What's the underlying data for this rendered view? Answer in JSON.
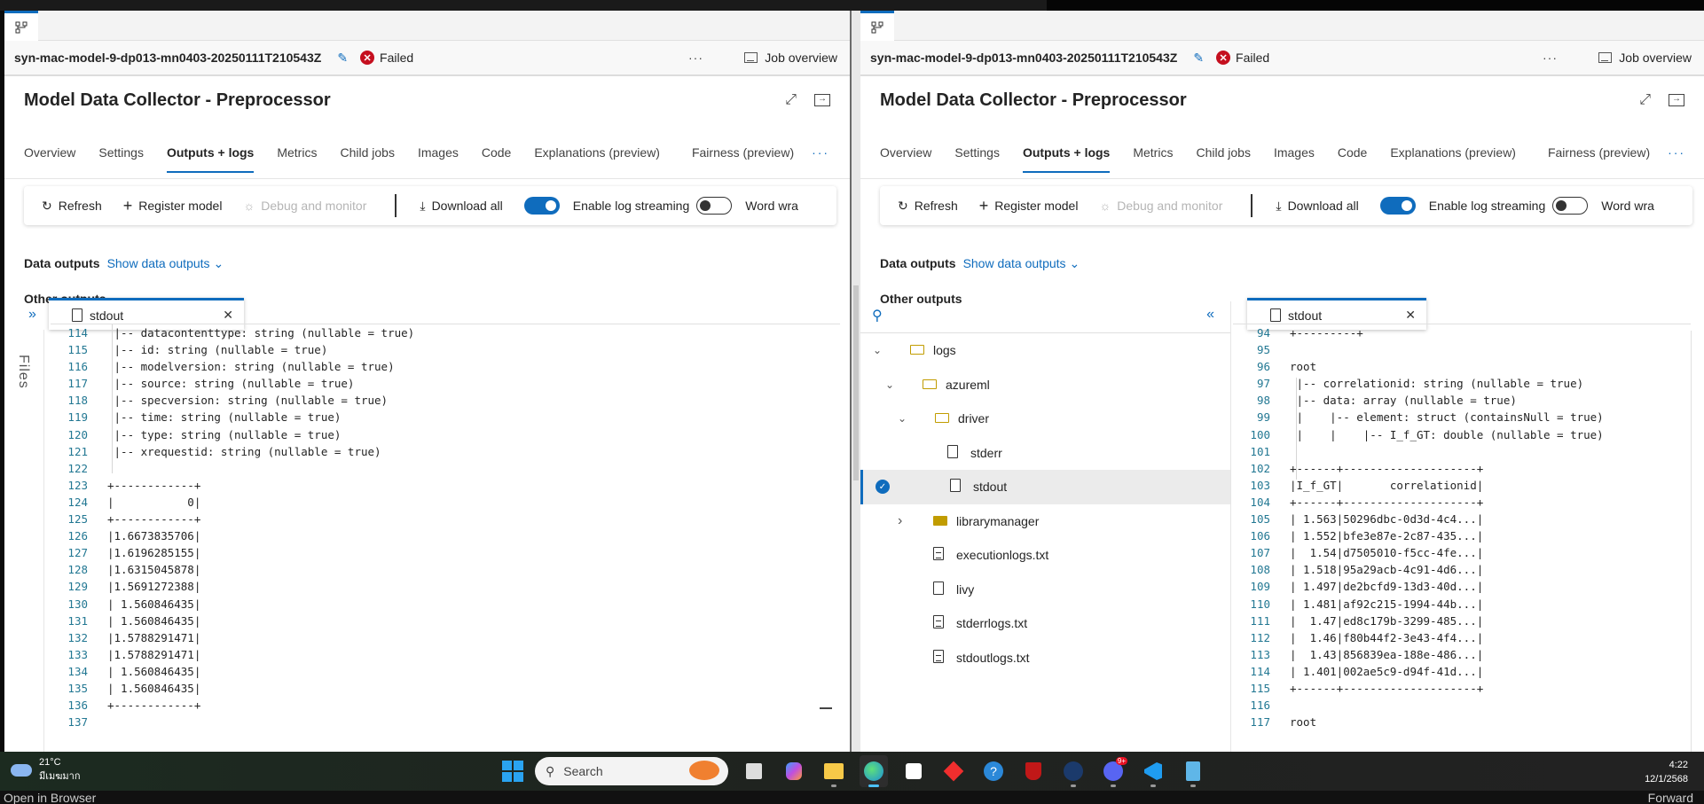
{
  "panels": [
    {
      "job_name": "syn-mac-model-9-dp013-mn0403-20250111T210543Z",
      "status": "Failed",
      "more_label": "···",
      "job_overview_label": "Job overview",
      "title": "Model Data Collector - Preprocessor",
      "tabs": [
        "Overview",
        "Settings",
        "Outputs + logs",
        "Metrics",
        "Child jobs",
        "Images",
        "Code",
        "Explanations (preview)",
        "Fairness (preview)"
      ],
      "active_tab": "Outputs + logs",
      "toolbar": {
        "refresh": "Refresh",
        "register_model": "Register model",
        "debug_monitor": "Debug and monitor",
        "download_all": "Download all",
        "enable_log_streaming": "Enable log streaming",
        "enable_log_streaming_on": true,
        "word_wrap": "Word wra",
        "word_wrap_on": false
      },
      "data_outputs_label": "Data outputs",
      "show_data_outputs": "Show data outputs",
      "other_outputs_label": "Other outputs",
      "open_file_tab": "stdout",
      "files_label": "Files",
      "code_lines": [
        {
          "n": "114",
          "t": " |-- datacontenttype: string (nullable = true)"
        },
        {
          "n": "115",
          "t": " |-- id: string (nullable = true)"
        },
        {
          "n": "116",
          "t": " |-- modelversion: string (nullable = true)"
        },
        {
          "n": "117",
          "t": " |-- source: string (nullable = true)"
        },
        {
          "n": "118",
          "t": " |-- specversion: string (nullable = true)"
        },
        {
          "n": "119",
          "t": " |-- time: string (nullable = true)"
        },
        {
          "n": "120",
          "t": " |-- type: string (nullable = true)"
        },
        {
          "n": "121",
          "t": " |-- xrequestid: string (nullable = true)"
        },
        {
          "n": "122",
          "t": ""
        },
        {
          "n": "123",
          "t": "+------------+"
        },
        {
          "n": "124",
          "t": "|           0|"
        },
        {
          "n": "125",
          "t": "+------------+"
        },
        {
          "n": "126",
          "t": "|1.6673835706|"
        },
        {
          "n": "127",
          "t": "|1.6196285155|"
        },
        {
          "n": "128",
          "t": "|1.6315045878|"
        },
        {
          "n": "129",
          "t": "|1.5691272388|"
        },
        {
          "n": "130",
          "t": "| 1.560846435|"
        },
        {
          "n": "131",
          "t": "| 1.560846435|"
        },
        {
          "n": "132",
          "t": "|1.5788291471|"
        },
        {
          "n": "133",
          "t": "|1.5788291471|"
        },
        {
          "n": "134",
          "t": "| 1.560846435|"
        },
        {
          "n": "135",
          "t": "| 1.560846435|"
        },
        {
          "n": "136",
          "t": "+------------+"
        },
        {
          "n": "137",
          "t": ""
        }
      ]
    },
    {
      "job_name": "syn-mac-model-9-dp013-mn0403-20250111T210543Z",
      "status": "Failed",
      "more_label": "···",
      "job_overview_label": "Job overview",
      "title": "Model Data Collector - Preprocessor",
      "tabs": [
        "Overview",
        "Settings",
        "Outputs + logs",
        "Metrics",
        "Child jobs",
        "Images",
        "Code",
        "Explanations (preview)",
        "Fairness (preview)"
      ],
      "active_tab": "Outputs + logs",
      "toolbar": {
        "refresh": "Refresh",
        "register_model": "Register model",
        "debug_monitor": "Debug and monitor",
        "download_all": "Download all",
        "enable_log_streaming": "Enable log streaming",
        "enable_log_streaming_on": true,
        "word_wrap": "Word wra",
        "word_wrap_on": false
      },
      "data_outputs_label": "Data outputs",
      "show_data_outputs": "Show data outputs",
      "other_outputs_label": "Other outputs",
      "open_file_tab": "stdout",
      "file_tree": [
        {
          "name": "logs",
          "type": "folder",
          "depth": 0,
          "expanded": true
        },
        {
          "name": "azureml",
          "type": "folder",
          "depth": 1,
          "expanded": true
        },
        {
          "name": "driver",
          "type": "folder",
          "depth": 2,
          "expanded": true
        },
        {
          "name": "stderr",
          "type": "file",
          "depth": 3
        },
        {
          "name": "stdout",
          "type": "file",
          "depth": 3,
          "selected": true
        },
        {
          "name": "librarymanager",
          "type": "folder-filled",
          "depth": 1,
          "expanded": false
        },
        {
          "name": "executionlogs.txt",
          "type": "file-lines",
          "depth": 1
        },
        {
          "name": "livy",
          "type": "file",
          "depth": 1
        },
        {
          "name": "stderrlogs.txt",
          "type": "file-lines",
          "depth": 1
        },
        {
          "name": "stdoutlogs.txt",
          "type": "file-lines",
          "depth": 1
        }
      ],
      "code_lines": [
        {
          "n": "94",
          "t": "+---------+"
        },
        {
          "n": "95",
          "t": ""
        },
        {
          "n": "96",
          "t": "root"
        },
        {
          "n": "97",
          "t": " |-- correlationid: string (nullable = true)"
        },
        {
          "n": "98",
          "t": " |-- data: array (nullable = true)"
        },
        {
          "n": "99",
          "t": " |    |-- element: struct (containsNull = true)"
        },
        {
          "n": "100",
          "t": " |    |    |-- I_f_GT: double (nullable = true)"
        },
        {
          "n": "101",
          "t": ""
        },
        {
          "n": "102",
          "t": "+------+--------------------+"
        },
        {
          "n": "103",
          "t": "|I_f_GT|       correlationid|"
        },
        {
          "n": "104",
          "t": "+------+--------------------+"
        },
        {
          "n": "105",
          "t": "| 1.563|50296dbc-0d3d-4c4...|"
        },
        {
          "n": "106",
          "t": "| 1.552|bfe3e87e-2c87-435...|"
        },
        {
          "n": "107",
          "t": "|  1.54|d7505010-f5cc-4fe...|"
        },
        {
          "n": "108",
          "t": "| 1.518|95a29acb-4c91-4d6...|"
        },
        {
          "n": "109",
          "t": "| 1.497|de2bcfd9-13d3-40d...|"
        },
        {
          "n": "110",
          "t": "| 1.481|af92c215-1994-44b...|"
        },
        {
          "n": "111",
          "t": "|  1.47|ed8c179b-3299-485...|"
        },
        {
          "n": "112",
          "t": "|  1.46|f80b44f2-3e43-4f4...|"
        },
        {
          "n": "113",
          "t": "|  1.43|856839ea-188e-486...|"
        },
        {
          "n": "114",
          "t": "| 1.401|002ae5c9-d94f-41d...|"
        },
        {
          "n": "115",
          "t": "+------+--------------------+"
        },
        {
          "n": "116",
          "t": ""
        },
        {
          "n": "117",
          "t": "root"
        }
      ]
    }
  ],
  "taskbar": {
    "weather_temp": "21°C",
    "weather_desc": "มีเมฆมาก",
    "search_placeholder": "Search",
    "apps": [
      "task-view",
      "copilot",
      "file-explorer",
      "edge",
      "store",
      "app-red",
      "help",
      "mcafee",
      "steam",
      "discord",
      "vscode",
      "notepad"
    ],
    "discord_badge": "9+",
    "time": "4:22",
    "date": "12/1/2568"
  },
  "background": {
    "left_text": "Open in Browser",
    "right_text": "Forward"
  }
}
